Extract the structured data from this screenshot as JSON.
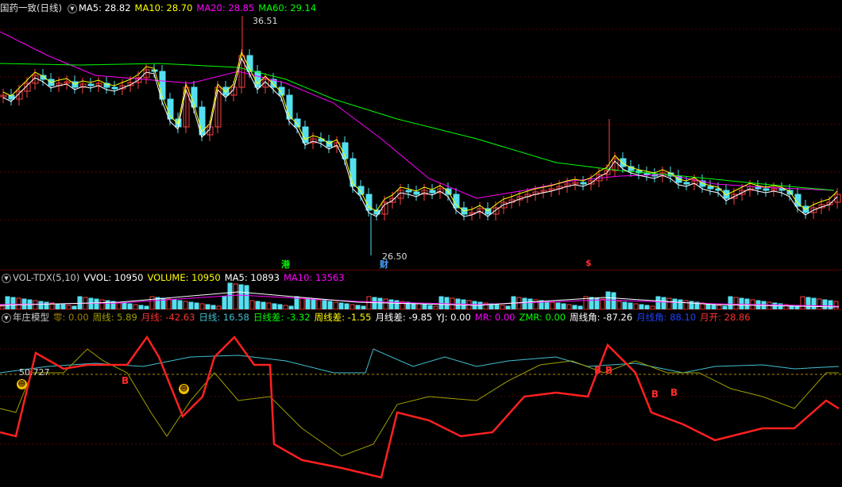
{
  "main": {
    "title": "国药一致(日线)",
    "ma": [
      {
        "label": "MA5: 28.82",
        "color": "#ffffff"
      },
      {
        "label": "MA10: 28.70",
        "color": "#ffff00"
      },
      {
        "label": "MA20: 28.85",
        "color": "#ff00ff"
      },
      {
        "label": "MA60: 29.14",
        "color": "#00ff00"
      }
    ],
    "high_label": "36.51",
    "low_label": "26.50",
    "event_markers": [
      {
        "text": "港",
        "color": "#00ff00"
      },
      {
        "text": "财",
        "color": "#4aa3ff"
      },
      {
        "text": "$",
        "color": "#ff3030"
      }
    ]
  },
  "vol": {
    "title": "VOL-TDX(5,10)",
    "items": [
      {
        "label": "VVOL: 10950",
        "color": "#ffffff"
      },
      {
        "label": "VOLUME: 10950",
        "color": "#ffff00"
      },
      {
        "label": "MA5: 10893",
        "color": "#ffffff"
      },
      {
        "label": "MA10: 13563",
        "color": "#ff00ff"
      }
    ]
  },
  "ind": {
    "title": "年庄模型",
    "items": [
      {
        "label": "零: 0.00",
        "color": "#a08000"
      },
      {
        "label": "周线: 5.89",
        "color": "#a0a000"
      },
      {
        "label": "月线: -42.63",
        "color": "#ff3030"
      },
      {
        "label": "日线: 16.58",
        "color": "#40c0d0"
      },
      {
        "label": "日线差: -3.32",
        "color": "#00ff00"
      },
      {
        "label": "周线差: -1.55",
        "color": "#ffff00"
      },
      {
        "label": "月线差: -9.85",
        "color": "#ffffff"
      },
      {
        "label": "YJ: 0.00",
        "color": "#ffffff"
      },
      {
        "label": "MR: 0.00",
        "color": "#ff00ff"
      },
      {
        "label": "ZMR: 0.00",
        "color": "#00ff00"
      },
      {
        "label": "周线角: -87.26",
        "color": "#ffffff"
      },
      {
        "label": "月线角: 88.10",
        "color": "#2040ff"
      },
      {
        "label": "月开: 28.86",
        "color": "#ff3030"
      }
    ],
    "ref_label": "50.727",
    "b_labels": [
      "B",
      "B",
      "B",
      "B",
      "B"
    ]
  },
  "chart_data": {
    "type": "candlestick",
    "price_range": [
      26.5,
      36.51
    ],
    "indicator_ref": 50.727
  }
}
